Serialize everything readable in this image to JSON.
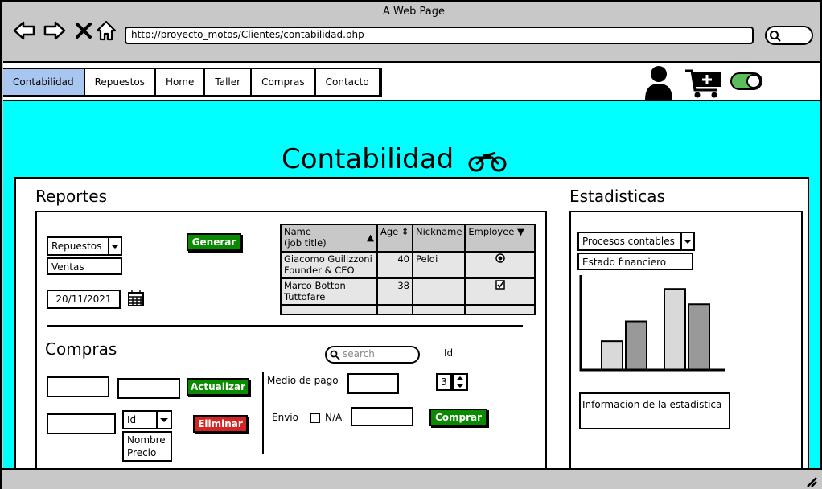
{
  "window": {
    "title": "A Web Page"
  },
  "browser": {
    "url": "http://proyecto_motos/Clientes/contabilidad.php",
    "icons": [
      "back-arrow-icon",
      "forward-arrow-icon",
      "close-x-icon",
      "home-icon",
      "search-icon"
    ]
  },
  "nav": {
    "tabs": [
      {
        "label": "Contabilidad",
        "active": true
      },
      {
        "label": "Repuestos",
        "active": false
      },
      {
        "label": "Home",
        "active": false
      },
      {
        "label": "Taller",
        "active": false
      },
      {
        "label": "Compras",
        "active": false
      },
      {
        "label": "Contacto",
        "active": false
      }
    ],
    "right_icons": [
      "user-icon",
      "cart-add-icon",
      "toggle-icon"
    ]
  },
  "page": {
    "heading": "Contabilidad",
    "heading_icon": "motorcycle-icon",
    "accent": "#00ffff"
  },
  "reportes": {
    "title": "Reportes",
    "select_value": "Repuestos",
    "select_option": "Ventas",
    "date": "20/11/2021",
    "generate_label": "Generar",
    "table": {
      "headers": [
        "Name\n(job title)",
        "Age",
        "Nickname",
        "Employee"
      ],
      "rows": [
        {
          "name": "Giacomo Guilizzoni",
          "title": "Founder & CEO",
          "age": "40",
          "nickname": "Peldi",
          "employee": "radio"
        },
        {
          "name": "Marco Botton",
          "title": "Tuttofare",
          "age": "38",
          "nickname": "",
          "employee": "check"
        }
      ]
    }
  },
  "compras": {
    "title": "Compras",
    "actualizar_label": "Actualizar",
    "eliminar_label": "Eliminar",
    "id_select": "Id",
    "id_options": [
      "Nombre",
      "Precio"
    ],
    "search_placeholder": "search",
    "id_label": "Id",
    "medio_pago_label": "Medio de pago",
    "stepper_value": "3",
    "envio_label": "Envio",
    "na_label": "N/A",
    "comprar_label": "Comprar"
  },
  "estadisticas": {
    "title": "Estadisticas",
    "select_value": "Procesos contables",
    "select_option": "Estado financiero",
    "info_text": "Informacion de la estadistica",
    "chart_data": {
      "type": "bar",
      "categories": [
        "",
        ""
      ],
      "series": [
        {
          "values": [
            32,
            90
          ]
        },
        {
          "values": [
            54,
            73
          ]
        }
      ],
      "ylim": [
        0,
        100
      ]
    }
  }
}
